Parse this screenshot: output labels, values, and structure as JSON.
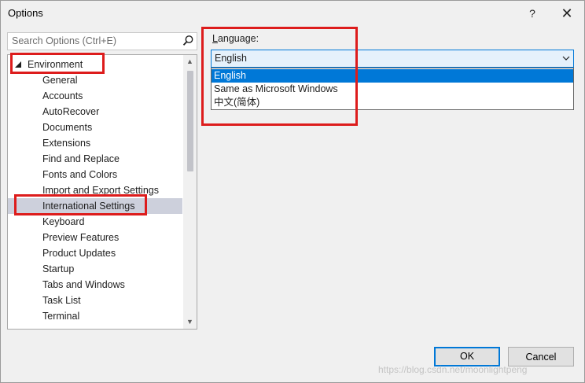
{
  "window": {
    "title": "Options",
    "help_glyph": "?",
    "close_glyph": "✕"
  },
  "search": {
    "placeholder": "Search Options (Ctrl+E)"
  },
  "tree": {
    "root_label": "Environment",
    "items": [
      "General",
      "Accounts",
      "AutoRecover",
      "Documents",
      "Extensions",
      "Find and Replace",
      "Fonts and Colors",
      "Import and Export Settings",
      "International Settings",
      "Keyboard",
      "Preview Features",
      "Product Updates",
      "Startup",
      "Tabs and Windows",
      "Task List",
      "Terminal"
    ],
    "selected_item": "International Settings"
  },
  "language": {
    "label_accel": "L",
    "label_rest": "anguage:",
    "selected_value": "English",
    "options": [
      "English",
      "Same as Microsoft Windows",
      "中文(简体)"
    ]
  },
  "buttons": {
    "ok": "OK",
    "cancel": "Cancel"
  },
  "watermark": "https://blog.csdn.net/moonlightpeng",
  "colors": {
    "accent": "#0078d7",
    "selection": "#cdd0dc",
    "annotation": "#dd1c1c"
  }
}
